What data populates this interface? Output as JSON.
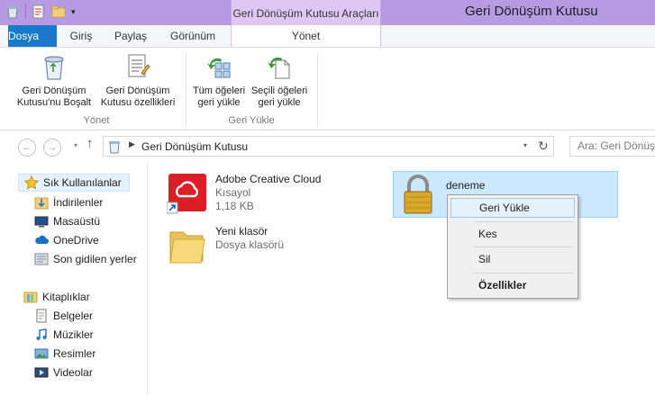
{
  "window": {
    "title": "Geri Dönüşüm Kutusu",
    "contextual_tab_group": "Geri Dönüşüm Kutusu Araçları"
  },
  "tabs": {
    "file": "Dosya",
    "home": "Giriş",
    "share": "Paylaş",
    "view": "Görünüm",
    "manage": "Yönet"
  },
  "ribbon": {
    "manage_group": {
      "label": "Yönet",
      "empty_bin_line1": "Geri Dönüşüm",
      "empty_bin_line2": "Kutusu'nu Boşalt",
      "bin_props_line1": "Geri Dönüşüm",
      "bin_props_line2": "Kutusu özellikleri"
    },
    "restore_group": {
      "label": "Geri Yükle",
      "restore_all_line1": "Tüm öğeleri",
      "restore_all_line2": "geri yükle",
      "restore_selected_line1": "Seçili öğeleri",
      "restore_selected_line2": "geri yükle"
    }
  },
  "address": {
    "location": "Geri Dönüşüm Kutusu",
    "search_placeholder": "Ara: Geri Dönüşüm Kutusu"
  },
  "nav": {
    "favorites": "Sık Kullanılanlar",
    "downloads": "İndirilenler",
    "desktop": "Masaüstü",
    "onedrive": "OneDrive",
    "recent": "Son gidilen yerler",
    "libraries": "Kitaplıklar",
    "documents": "Belgeler",
    "music": "Müzikler",
    "pictures": "Resimler",
    "videos": "Videolar"
  },
  "files": [
    {
      "name": "Adobe Creative Cloud",
      "type": "Kısayol",
      "size": "1,18 KB"
    },
    {
      "name": "Yeni klasör",
      "type": "Dosya klasörü"
    },
    {
      "name": "deneme"
    }
  ],
  "context_menu": {
    "restore": "Geri Yükle",
    "cut": "Kes",
    "delete": "Sil",
    "properties": "Özellikler"
  },
  "colors": {
    "titlebar": "#b69be3",
    "file_tab": "#1979ca",
    "contextual_header": "#e0c6f2",
    "selection": "#cce8ff"
  }
}
